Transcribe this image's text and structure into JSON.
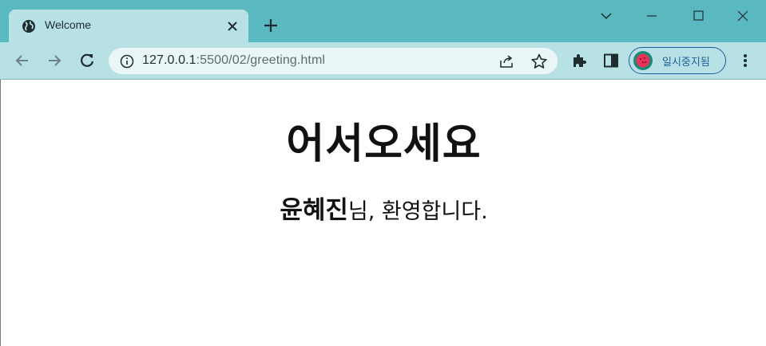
{
  "tab": {
    "title": "Welcome"
  },
  "address_bar": {
    "host": "127.0.0.1",
    "path": ":5500/02/greeting.html"
  },
  "profile": {
    "label": "일시중지됨"
  },
  "page": {
    "heading": "어서오세요",
    "name": "윤혜진",
    "greeting_suffix": "님, 환영합니다."
  },
  "colors": {
    "titlebar": "#5ab8c1",
    "toolbar": "#b8e1e5",
    "omnibox": "#ebf6f7",
    "profile_border": "#1d5f9c"
  }
}
